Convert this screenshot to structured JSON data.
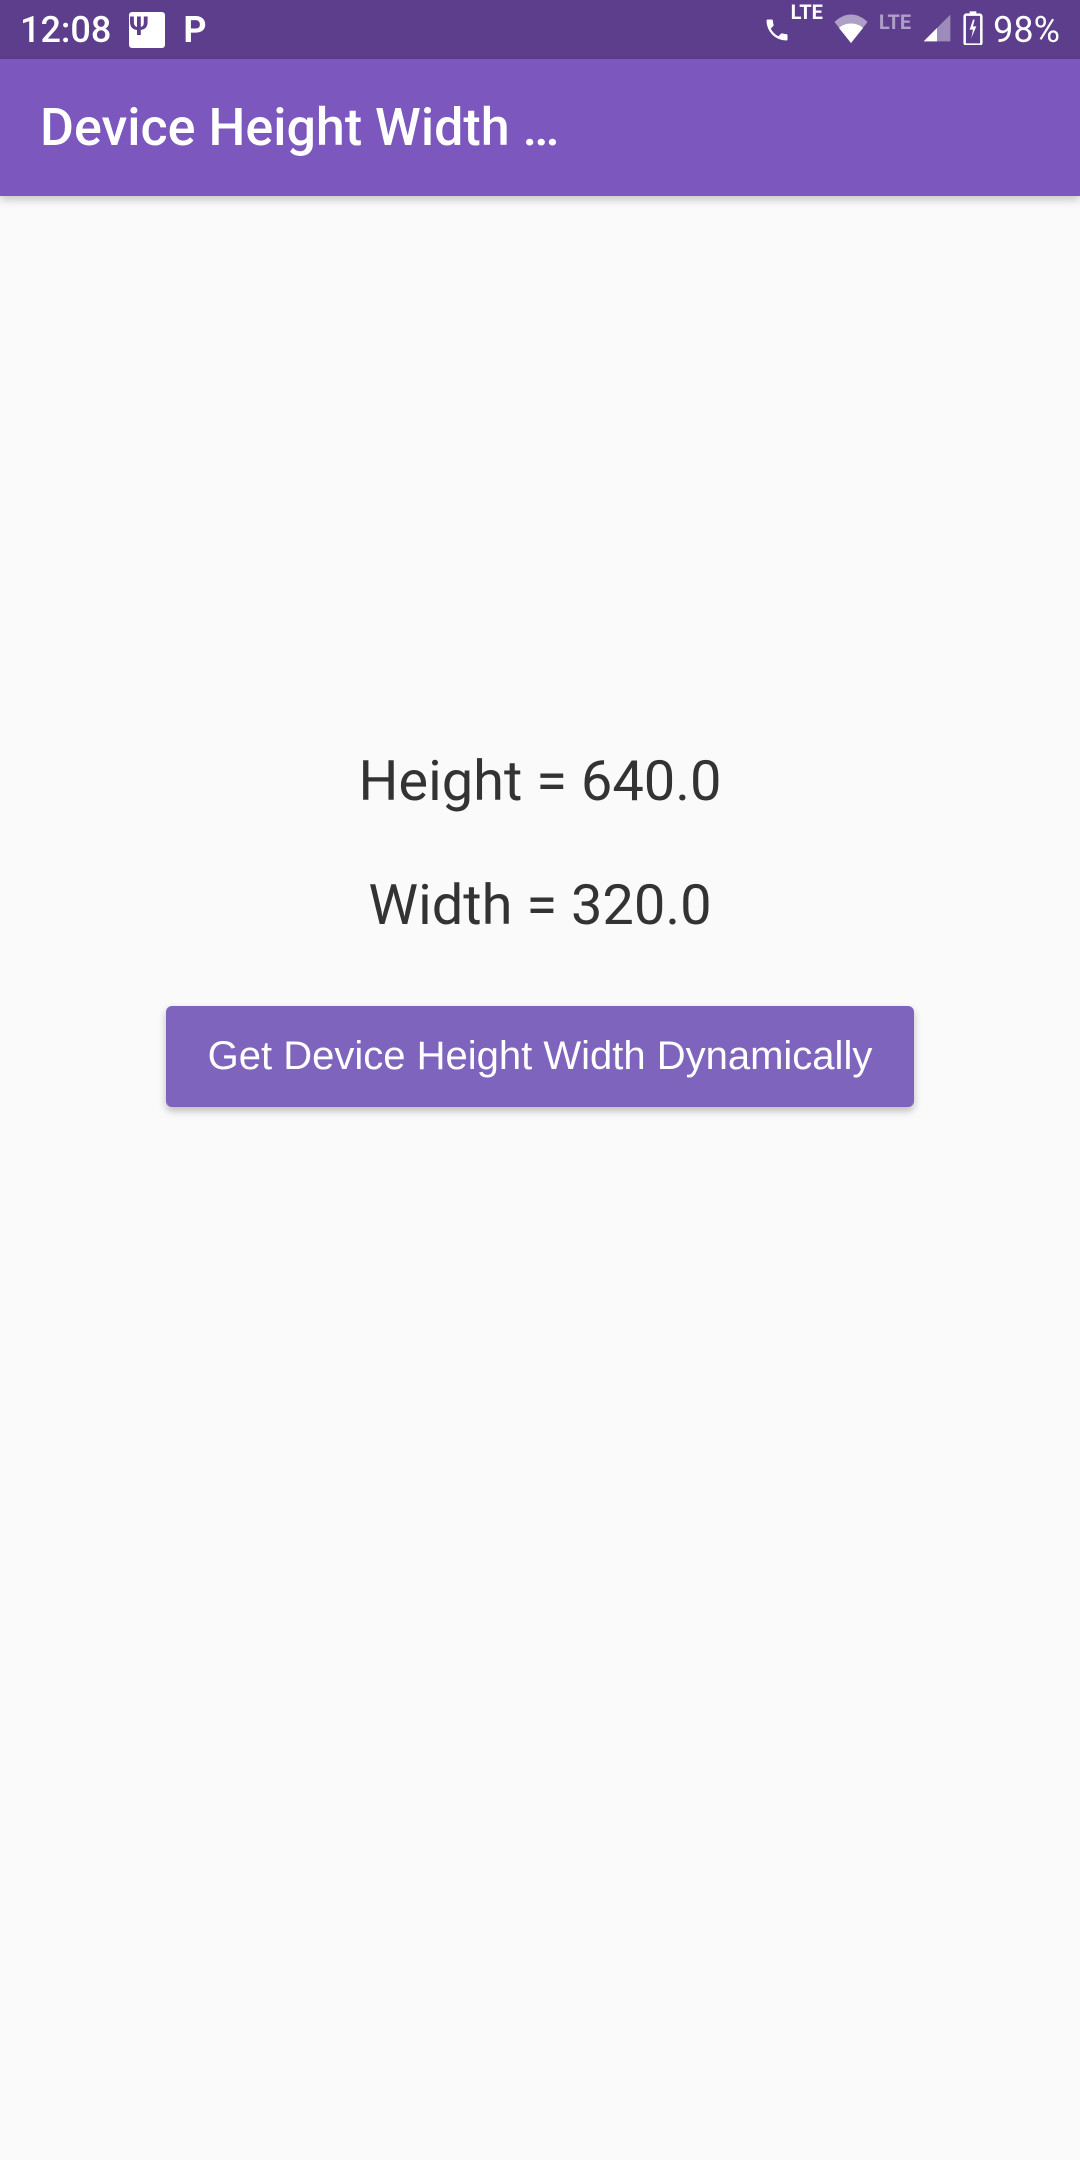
{
  "status_bar": {
    "time": "12:08",
    "battery_percent": "98%",
    "lte_label_1": "LTE",
    "lte_label_2": "LTE"
  },
  "app_bar": {
    "title": "Device Height Width …"
  },
  "main": {
    "height_text": "Height = 640.0",
    "width_text": "Width = 320.0",
    "button_label": "Get Device Height Width Dynamically"
  }
}
